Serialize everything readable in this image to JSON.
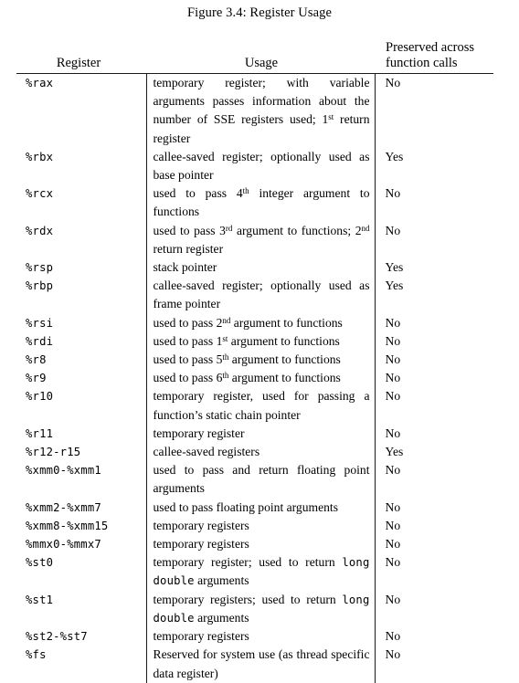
{
  "figure": {
    "caption": "Figure 3.4: Register Usage"
  },
  "table": {
    "headers": {
      "register": "Register",
      "usage": "Usage",
      "preserved_line1": "Preserved across",
      "preserved_line2": "function calls"
    },
    "rows": [
      {
        "register": "%rax",
        "usage": "temporary register; with variable arguments passes information about the number of SSE registers used; 1st return register",
        "preserved": "No"
      },
      {
        "register": "%rbx",
        "usage": "callee-saved register; optionally used as base pointer",
        "preserved": "Yes"
      },
      {
        "register": "%rcx",
        "usage": "used to pass 4th integer argument to functions",
        "preserved": "No"
      },
      {
        "register": "%rdx",
        "usage": "used to pass 3rd argument to functions; 2nd return register",
        "preserved": "No"
      },
      {
        "register": "%rsp",
        "usage": "stack pointer",
        "preserved": "Yes"
      },
      {
        "register": "%rbp",
        "usage": "callee-saved register; optionally used as frame pointer",
        "preserved": "Yes"
      },
      {
        "register": "%rsi",
        "usage": "used to pass 2nd argument to functions",
        "preserved": "No"
      },
      {
        "register": "%rdi",
        "usage": "used to pass 1st argument to functions",
        "preserved": "No"
      },
      {
        "register": "%r8",
        "usage": "used to pass 5th argument to functions",
        "preserved": "No"
      },
      {
        "register": "%r9",
        "usage": "used to pass 6th argument to functions",
        "preserved": "No"
      },
      {
        "register": "%r10",
        "usage": "temporary register, used for passing a function's static chain pointer",
        "preserved": "No"
      },
      {
        "register": "%r11",
        "usage": "temporary register",
        "preserved": "No"
      },
      {
        "register": "%r12-r15",
        "usage": "callee-saved registers",
        "preserved": "Yes"
      },
      {
        "register": "%xmm0-%xmm1",
        "usage": "used to pass and return floating point arguments",
        "preserved": "No"
      },
      {
        "register": "%xmm2-%xmm7",
        "usage": "used to pass floating point arguments",
        "preserved": "No"
      },
      {
        "register": "%xmm8-%xmm15",
        "usage": "temporary registers",
        "preserved": "No"
      },
      {
        "register": "%mmx0-%mmx7",
        "usage": "temporary registers",
        "preserved": "No"
      },
      {
        "register": "%st0",
        "usage": "temporary register; used to return long double arguments",
        "preserved": "No"
      },
      {
        "register": "%st1",
        "usage": "temporary registers; used to return long double arguments",
        "preserved": "No"
      },
      {
        "register": "%st2-%st7",
        "usage": "temporary registers",
        "preserved": "No"
      },
      {
        "register": "%fs",
        "usage": "Reserved for system use (as thread specific data register)",
        "preserved": "No"
      }
    ]
  }
}
